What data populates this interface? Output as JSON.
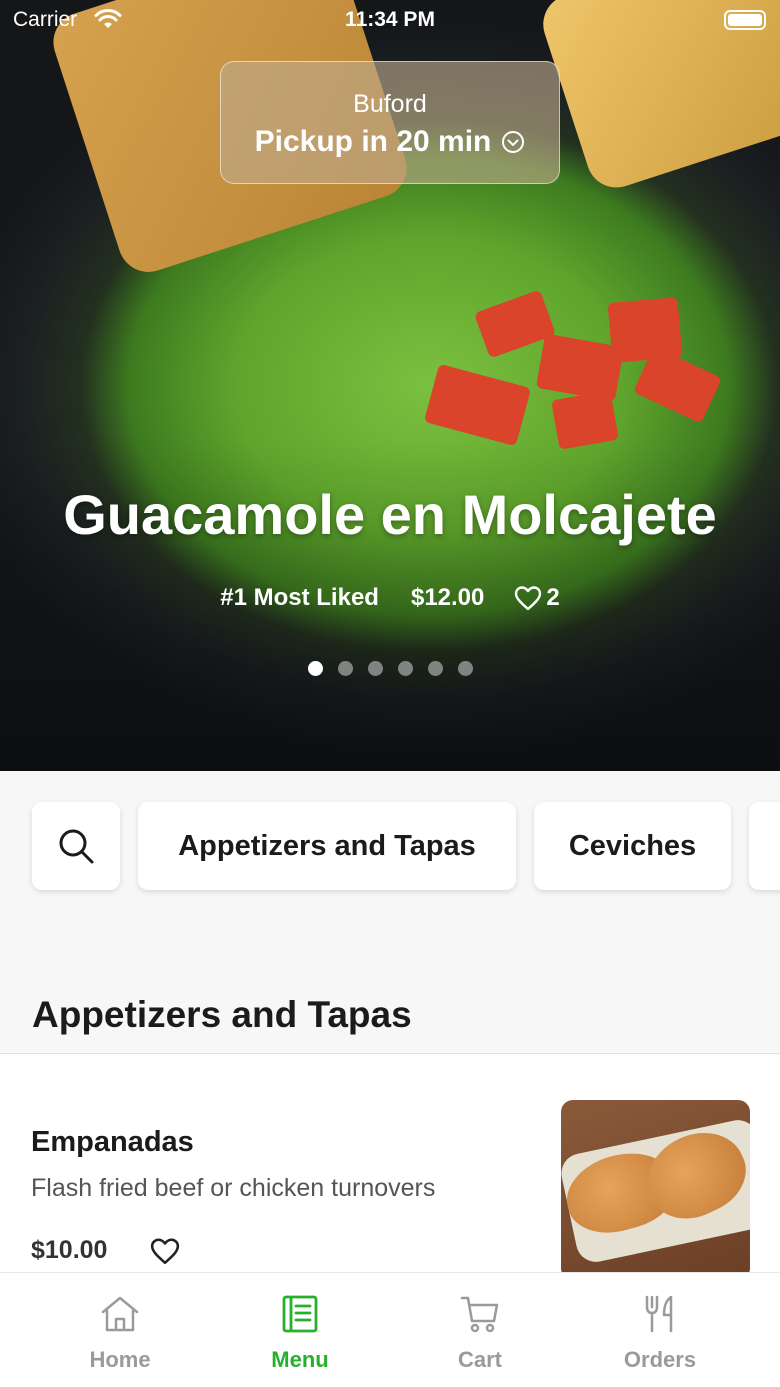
{
  "status_bar": {
    "carrier": "Carrier",
    "time": "11:34 PM"
  },
  "location": {
    "city": "Buford",
    "pickup": "Pickup in 20 min"
  },
  "featured": {
    "title": "Guacamole en Molcajete",
    "rank": "#1 Most Liked",
    "price": "$12.00",
    "likes": "2",
    "carousel_count": 6,
    "carousel_active": 1
  },
  "categories": [
    {
      "label": "Appetizers and Tapas"
    },
    {
      "label": "Ceviches"
    }
  ],
  "section": {
    "title": "Appetizers and Tapas"
  },
  "menu_items": [
    {
      "name": "Empanadas",
      "description": "Flash fried beef or chicken turnovers",
      "price": "$10.00"
    }
  ],
  "tabs": [
    {
      "label": "Home",
      "icon": "home-icon",
      "active": false
    },
    {
      "label": "Menu",
      "icon": "menu-icon",
      "active": true
    },
    {
      "label": "Cart",
      "icon": "cart-icon",
      "active": false
    },
    {
      "label": "Orders",
      "icon": "utensils-icon",
      "active": false
    }
  ],
  "colors": {
    "accent": "#27b02d",
    "inactive": "#9a9a9a"
  }
}
